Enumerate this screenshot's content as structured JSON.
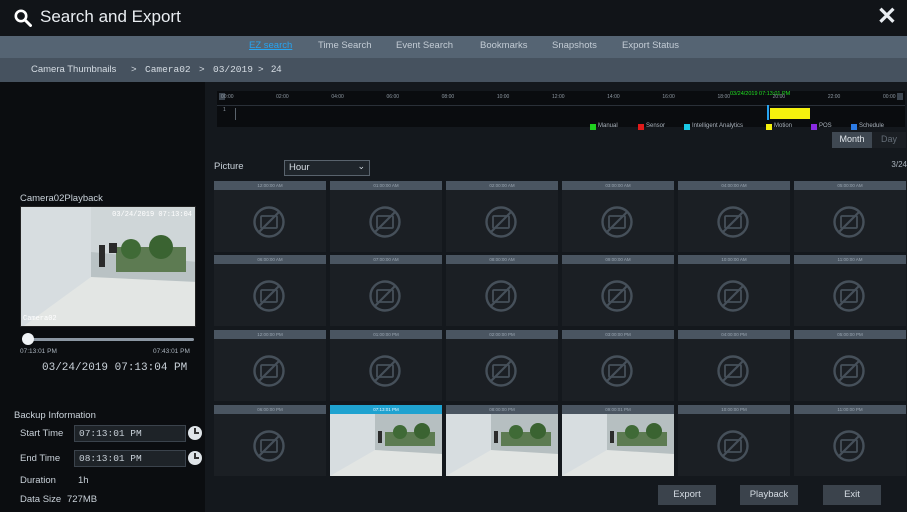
{
  "app": {
    "title": "Search and Export"
  },
  "tabs": [
    {
      "label": "EZ search",
      "active": true
    },
    {
      "label": "Time Search",
      "active": false
    },
    {
      "label": "Event Search",
      "active": false
    },
    {
      "label": "Bookmarks",
      "active": false
    },
    {
      "label": "Snapshots",
      "active": false
    },
    {
      "label": "Export Status",
      "active": false
    }
  ],
  "breadcrumb": [
    "Camera Thumbnails",
    ">",
    "Camera02",
    ">",
    "03/2019",
    ">",
    "24"
  ],
  "playback": {
    "title": "Camera02Playback",
    "camera_osd": "Camera02",
    "time_osd": "03/24/2019 07:13:04",
    "range_start": "07:13:01 PM",
    "range_end": "07:43:01 PM",
    "current_timestamp": "03/24/2019 07:13:04 PM"
  },
  "backup": {
    "title": "Backup Information",
    "start_label": "Start Time",
    "start_value": "07:13:01 PM",
    "end_label": "End Time",
    "end_value": "08:13:01 PM",
    "duration_label": "Duration",
    "duration_value": "1h",
    "size_label": "Data Size",
    "size_value": "727MB"
  },
  "timeline": {
    "hours": [
      "00:00",
      "02:00",
      "04:00",
      "06:00",
      "08:00",
      "10:00",
      "12:00",
      "14:00",
      "16:00",
      "18:00",
      "20:00",
      "22:00",
      "00:00"
    ],
    "cursor_timestamp": "03/24/2019 07:13:01 PM",
    "track_label": "1",
    "legend": [
      {
        "label": "Manual",
        "color": "#1fd11f"
      },
      {
        "label": "Sensor",
        "color": "#e01a1a"
      },
      {
        "label": "Intelligent Analytics",
        "color": "#19c9e6"
      },
      {
        "label": "Motion",
        "color": "#f5f10d"
      },
      {
        "label": "POS",
        "color": "#8a2be2"
      },
      {
        "label": "Schedule",
        "color": "#2c7be5"
      }
    ],
    "mode_month": "Month",
    "mode_day": "Day"
  },
  "picture": {
    "label": "Picture",
    "interval": "Hour",
    "page_indicator": "3/24"
  },
  "thumbnails": [
    {
      "label": "12:00:00 AM",
      "has_video": false,
      "selected": false
    },
    {
      "label": "01:00:00 AM",
      "has_video": false,
      "selected": false
    },
    {
      "label": "02:00:00 AM",
      "has_video": false,
      "selected": false
    },
    {
      "label": "03:00:00 AM",
      "has_video": false,
      "selected": false
    },
    {
      "label": "04:00:00 AM",
      "has_video": false,
      "selected": false
    },
    {
      "label": "05:00:00 AM",
      "has_video": false,
      "selected": false
    },
    {
      "label": "06:00:00 AM",
      "has_video": false,
      "selected": false
    },
    {
      "label": "07:00:00 AM",
      "has_video": false,
      "selected": false
    },
    {
      "label": "08:00:00 AM",
      "has_video": false,
      "selected": false
    },
    {
      "label": "09:00:00 AM",
      "has_video": false,
      "selected": false
    },
    {
      "label": "10:00:00 AM",
      "has_video": false,
      "selected": false
    },
    {
      "label": "11:00:00 AM",
      "has_video": false,
      "selected": false
    },
    {
      "label": "12:00:00 PM",
      "has_video": false,
      "selected": false
    },
    {
      "label": "01:00:00 PM",
      "has_video": false,
      "selected": false
    },
    {
      "label": "02:00:00 PM",
      "has_video": false,
      "selected": false
    },
    {
      "label": "03:00:00 PM",
      "has_video": false,
      "selected": false
    },
    {
      "label": "04:00:00 PM",
      "has_video": false,
      "selected": false
    },
    {
      "label": "05:00:00 PM",
      "has_video": false,
      "selected": false
    },
    {
      "label": "06:00:00 PM",
      "has_video": false,
      "selected": false
    },
    {
      "label": "07:13:01 PM",
      "has_video": true,
      "selected": true
    },
    {
      "label": "08:00:00 PM",
      "has_video": true,
      "selected": false
    },
    {
      "label": "09:00:01 PM",
      "has_video": true,
      "selected": false
    },
    {
      "label": "10:00:00 PM",
      "has_video": false,
      "selected": false
    },
    {
      "label": "11:00:00 PM",
      "has_video": false,
      "selected": false
    }
  ],
  "actions": {
    "export": "Export",
    "playback": "Playback",
    "exit": "Exit"
  },
  "icons": {
    "search": "search-icon",
    "close": "close-icon",
    "clock": "clock-icon",
    "no_image": "no-image-icon"
  }
}
